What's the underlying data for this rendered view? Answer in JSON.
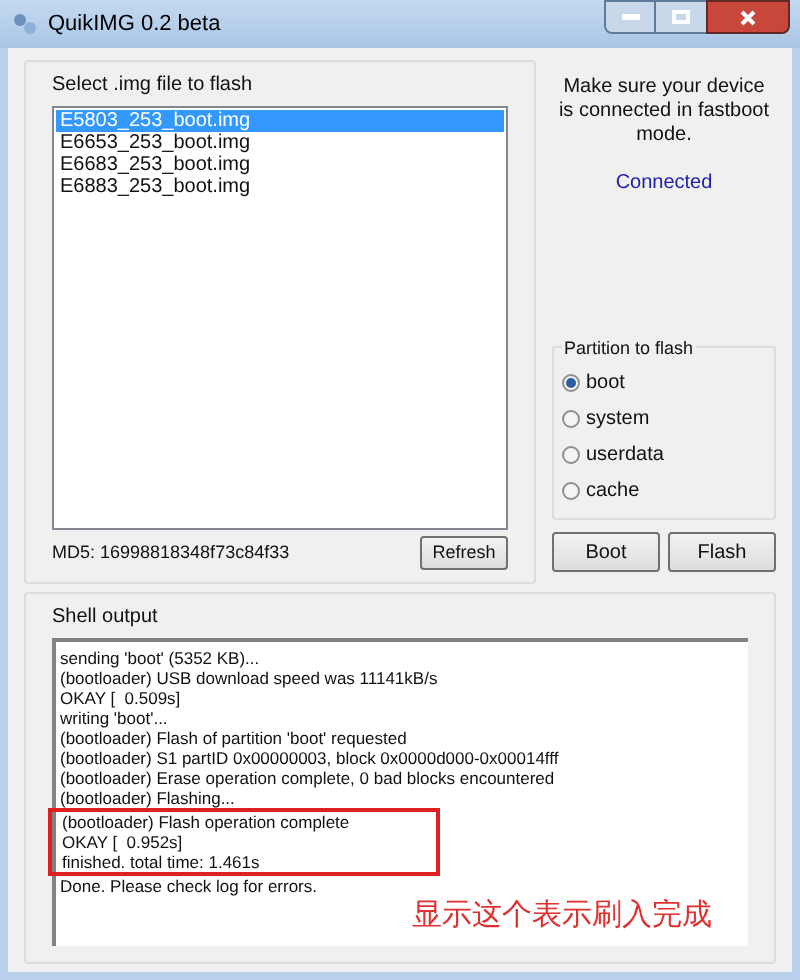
{
  "window": {
    "title": "QuikIMG 0.2 beta"
  },
  "file_group": {
    "label": "Select .img file to flash",
    "files": [
      {
        "name": "E5803_253_boot.img",
        "selected": true
      },
      {
        "name": "E6653_253_boot.img",
        "selected": false
      },
      {
        "name": "E6683_253_boot.img",
        "selected": false
      },
      {
        "name": "E6883_253_boot.img",
        "selected": false
      }
    ],
    "md5": "MD5: 16998818348f73c84f33",
    "refresh_button": "Refresh"
  },
  "device": {
    "message": "Make sure your device is connected in fastboot mode.",
    "status": "Connected"
  },
  "partition_group": {
    "label": "Partition to flash",
    "options": [
      {
        "label": "boot",
        "selected": true
      },
      {
        "label": "system",
        "selected": false
      },
      {
        "label": "userdata",
        "selected": false
      },
      {
        "label": "cache",
        "selected": false
      }
    ]
  },
  "buttons": [
    "Boot",
    "Flash"
  ],
  "shell": {
    "label": "Shell output",
    "lines": [
      {
        "text": "sending 'boot' (5352 KB)...",
        "boxed": false
      },
      {
        "text": "(bootloader) USB download speed was 11141kB/s",
        "boxed": false
      },
      {
        "text": "OKAY [  0.509s]",
        "boxed": false
      },
      {
        "text": "writing 'boot'...",
        "boxed": false
      },
      {
        "text": "(bootloader) Flash of partition 'boot' requested",
        "boxed": false
      },
      {
        "text": "(bootloader) S1 partID 0x00000003, block 0x0000d000-0x00014fff",
        "boxed": false
      },
      {
        "text": "(bootloader) Erase operation complete, 0 bad blocks encountered",
        "boxed": false
      },
      {
        "text": "(bootloader) Flashing...",
        "boxed": false
      },
      {
        "text": "(bootloader) Flash operation complete",
        "boxed": true
      },
      {
        "text": "OKAY [  0.952s]",
        "boxed": true
      },
      {
        "text": "finished. total time: 1.461s",
        "boxed": true
      },
      {
        "text": "Done. Please check log for errors.",
        "boxed": false
      }
    ],
    "annotation": "显示这个表示刷入完成"
  }
}
